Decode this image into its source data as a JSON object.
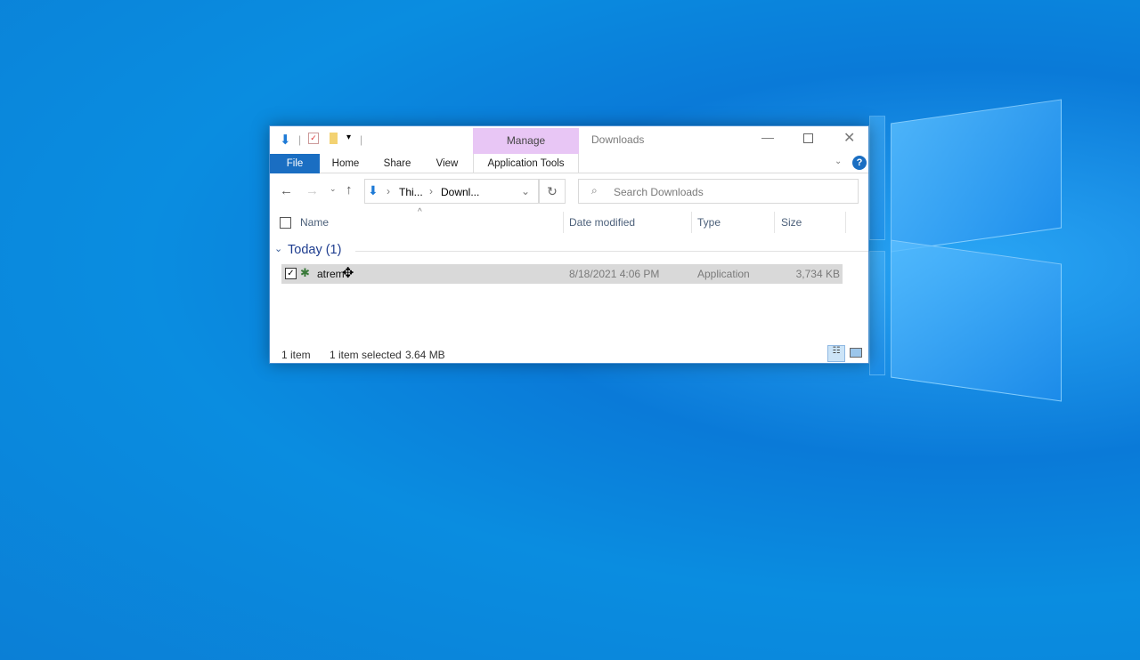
{
  "titlebar": {
    "title": "Downloads",
    "context_group": "Manage"
  },
  "ribbon": {
    "tabs": [
      "File",
      "Home",
      "Share",
      "View",
      "Application Tools"
    ],
    "accent": "#1a6ec2",
    "context_color": "#e8c6f5"
  },
  "nav": {
    "breadcrumb": [
      "Thi...",
      "Downl..."
    ],
    "search_placeholder": "Search Downloads"
  },
  "columns": [
    "Name",
    "Date modified",
    "Type",
    "Size"
  ],
  "group": {
    "label": "Today (1)"
  },
  "files": [
    {
      "name": "atrem",
      "date": "8/18/2021 4:06 PM",
      "type": "Application",
      "size": "3,734 KB",
      "selected": true
    }
  ],
  "status": {
    "count": "1 item",
    "selection": "1 item selected",
    "size": "3.64 MB"
  }
}
